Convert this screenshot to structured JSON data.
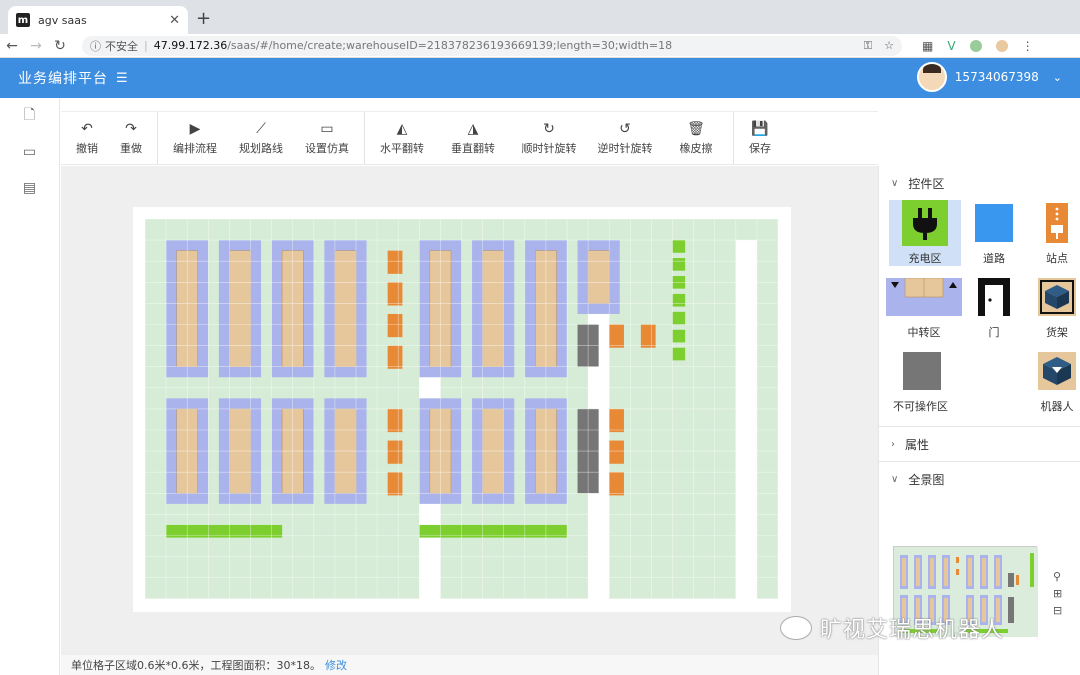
{
  "browser": {
    "tab_title": "agv saas",
    "favicon_letter": "m",
    "insecure_label": "不安全",
    "url_host": "47.99.172.36",
    "url_path": "/saas/#/home/create;warehouseID=218378236193669139;length=30;width=18"
  },
  "header": {
    "title": "业务编排平台",
    "username": "15734067398"
  },
  "left_nav": [
    {
      "icon": "file-icon"
    },
    {
      "icon": "folder-icon"
    },
    {
      "icon": "report-icon"
    }
  ],
  "toolbar": {
    "undo": "撤销",
    "redo": "重做",
    "orchestrate": "编排流程",
    "plan_route": "规划路线",
    "simulation": "设置仿真",
    "flip_h": "水平翻转",
    "flip_v": "垂直翻转",
    "rotate_cw": "顺时针旋转",
    "rotate_ccw": "逆时针旋转",
    "eraser": "橡皮擦",
    "save": "保存"
  },
  "right_panel": {
    "widgets_title": "控件区",
    "widgets": [
      "充电区",
      "道路",
      "站点",
      "中转区",
      "门",
      "货架",
      "不可操作区",
      "机器人"
    ],
    "properties_title": "属性",
    "overview_title": "全景图"
  },
  "status": {
    "text": "单位格子区域0.6米*0.6米，工程图面积：30*18。",
    "edit_link": "修改"
  },
  "grid": {
    "columns": 30,
    "rows": 18
  },
  "colors": {
    "header": "#3d8ee0",
    "road": "#d6ecd6",
    "shelf": "#e6c79c",
    "transfer": "#aab3ec",
    "station": "#e88a35",
    "charger": "#7ccf2e",
    "blocked": "#767676"
  },
  "watermark": "旷视艾瑞思机器人"
}
